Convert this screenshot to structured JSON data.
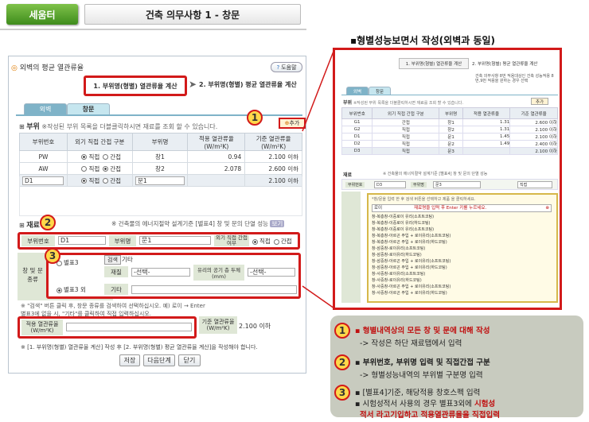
{
  "header": {
    "tag": "세움터",
    "title": "건축 의무사항 1 - 창문"
  },
  "dialog": {
    "title": "외벽의 평균 열관류율",
    "help": "도움말",
    "step1": "1. 부위명(형별) 열관류율 계산",
    "step2": "2. 부위명(형별) 평균 열관류율 계산",
    "tabs": [
      "외벽",
      "창문"
    ],
    "part_section": "부위",
    "part_hint": "※작성된 부위 목록을 더블클릭하시면 재료를 조회 할 수 있습니다.",
    "add_button": "추가",
    "table": {
      "headers": [
        "부위번호",
        "외기 직접 간접 구분",
        "부위명",
        "적용 열관류율 (W/m²K)",
        "기준 열관류율 (W/m²K)"
      ],
      "direct": "직접",
      "indirect": "간접",
      "rows": [
        {
          "no": "PW",
          "name": "창1",
          "applied": "0.94",
          "std": "2.100 이하"
        },
        {
          "no": "AW",
          "name": "창2",
          "applied": "2.078",
          "std": "2.600 이하"
        },
        {
          "no": "D1",
          "name": "문1",
          "applied": "",
          "std": "2.100 이하"
        }
      ]
    },
    "material_section": "재료",
    "material_note": "※ 건축물의 에너지절약 설계기준 [별표4] 창 및 문의 단열 성능",
    "material_badge": "보기",
    "part_no_label": "부위번호",
    "part_no_value": "D1",
    "part_name_label": "부위명",
    "part_name_value": "문1",
    "outer_label": "외기 직접 간접 여부",
    "window_label": "창 및 문 종류",
    "table3": "별표3",
    "table3_other": "별표3 외",
    "search": "검색",
    "other": "기타",
    "material": "재질",
    "select": "-선택-",
    "glass_gap": "유리의 공기 층 두께(mm)",
    "other2": "기타",
    "note_line1": "※ \"검색\" 버튼 클릭 후, 창문 종류를 검색하여 선택하십시오. 예) 로이 → Enter",
    "note_line2": "  별표3에 없을 시, \"기타\"를 클릭하여 직접 입력하십시오.",
    "u_label": "적용 열관류율 (W/m²K)",
    "std_label": "기준 열관류율 (W/m²K)",
    "std_value": "2.100 이하",
    "footer_note": "※ [1. 부위명(형별) 열관류율 계산] 작성 후 [2. 부위명(형별) 평균 열관류율 계산]을 작성해야 합니다.",
    "buttons": [
      "저장",
      "다음단계",
      "닫기"
    ]
  },
  "right": {
    "title": "▪형별성능보면서 작성(외벽과 동일)",
    "inset": {
      "step1": "1. 부위명(형별) 열관류율 계산",
      "step2": "2. 부위명(형별) 평균 열관류율 계산",
      "note": "건축 의무사항 8번 적용대상인 건축 성능적용 8번,9번 적용을 원하는 경우 선택",
      "tabs": [
        "외벽",
        "창문"
      ],
      "part_section": "부위",
      "hint": "※작성된 부위 목록을 더블클릭하시면 재료를 조회 할 수 있습니다.",
      "add": "추가",
      "headers": [
        "부위번호",
        "외기 직접 간접 구분",
        "부위명",
        "적용 열관류율",
        "기준 열관류율"
      ],
      "rows": [
        {
          "no": "G1",
          "kind": "간접",
          "name": "창1",
          "applied": "1.31",
          "std": "2.600 이하"
        },
        {
          "no": "G2",
          "kind": "직접",
          "name": "창2",
          "applied": "1.31",
          "std": "2.100 이하"
        },
        {
          "no": "D1",
          "kind": "직접",
          "name": "문1",
          "applied": "1.45",
          "std": "2.100 이하"
        },
        {
          "no": "D2",
          "kind": "직접",
          "name": "문2",
          "applied": "1.49",
          "std": "2.400 이하"
        },
        {
          "no": "D3",
          "kind": "직접",
          "name": "문3",
          "applied": "",
          "std": "2.100 이하"
        }
      ],
      "material_section": "재료",
      "material_note": "※ 건축물의 에너지절약 설계기준 [별표4] 창 및 문의 단열 성능",
      "part_no": "D3",
      "part_name": "문3",
      "outer": "직접",
      "popup_hint": "*창/문을 입력 한 후 검색 버튼을 선택하고 제품 을 클릭하세요.",
      "popup_input": "로이",
      "popup_msg": "재료명을 입력 후 Enter 키를 누르세요.",
      "popup_items": [
        "창-복층창-이중로이 유리(소프트코팅)",
        "창-복층창-이중로이 유리(하드코팅)",
        "창-복층창-이중로이 유리(소프트코팅)",
        "창-복층창-아르곤 주입 + 로이유리(소프트코팅)",
        "창-복층창-아르곤 주입 + 로이유리(하드코팅)",
        "창-삼중창-로이유리(소프트코팅)",
        "창-삼중창-로이유리(하드코팅)",
        "창-삼중창-아르곤 주입 + 로이유리(소프트코팅)",
        "창-삼중창-아르곤 주입 + 로이유리(하드코팅)",
        "창-사중창-로이유리(소프트코팅)",
        "창-사중창-로이유리(하드코팅)",
        "창-사중창-아르곤 주입 + 로이유리(소프트코팅)",
        "창-사중창-아르곤 주입 + 로이유리(하드코팅)"
      ]
    },
    "info": {
      "l1": "▪ 형별내역상의 모든 창 및 문에 대해 작성",
      "l1b": "-> 작성은 하단 재료탭에서 입력",
      "l2": "▪ 부위번호, 부위명 입력 및 직접간접 구분",
      "l2b": "-> 형별성능내역의 부위별 구분명 입력",
      "l3": "▪ [별표4]기준, 해당적용 창호스펙 입력",
      "l3b_a": "▪ 시험성적서 사용의 경우 별표3외에 ",
      "l3b_b": "시험성",
      "l3c": "적서 라고기입하고 적용열관류율을 직접입력"
    },
    "circles": [
      "1",
      "2",
      "3"
    ]
  }
}
